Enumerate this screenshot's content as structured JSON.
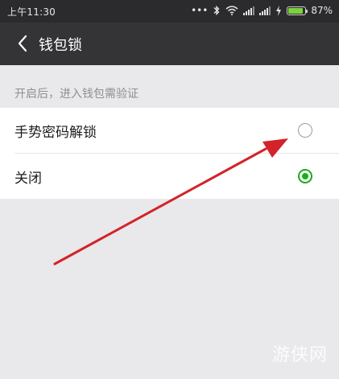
{
  "status_bar": {
    "time": "上午11:30",
    "dots": "•••",
    "battery_percent": "87%",
    "battery_level": 0.87
  },
  "header": {
    "title": "钱包锁"
  },
  "section": {
    "hint": "开启后，进入钱包需验证"
  },
  "options": [
    {
      "label": "手势密码解锁",
      "selected": false
    },
    {
      "label": "关闭",
      "selected": true
    }
  ],
  "watermark": "游侠网",
  "colors": {
    "status_bar_bg": "#2b2b2d",
    "title_bar_bg": "#343436",
    "page_bg": "#e9e8ea",
    "accent_green": "#1aad19",
    "annotation_arrow": "#d2232a"
  }
}
